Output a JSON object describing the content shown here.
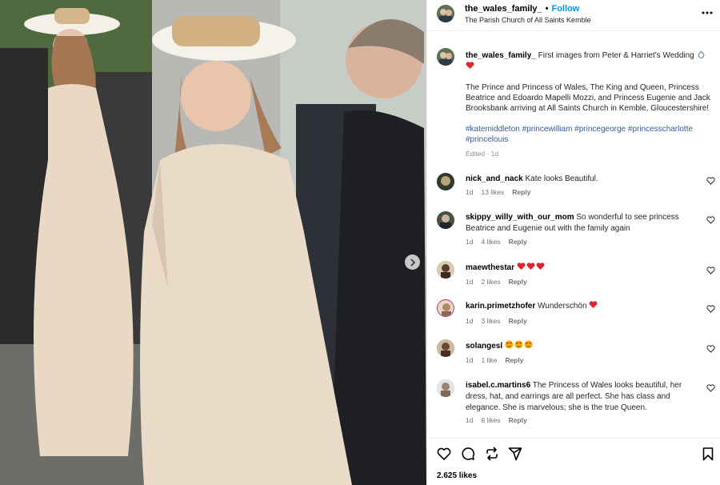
{
  "post": {
    "username": "the_wales_family_",
    "separator": "•",
    "follow_label": "Follow",
    "location": "The Parish Church of All Saints Kemble",
    "more_icon": "more-horizontal-icon"
  },
  "caption": {
    "username": "the_wales_family_",
    "text": "First images from Peter & Harriet's Wedding",
    "body": "The Prince and Princess of Wales, The King and Queen, Princess Beatrice and Edoardo Mapelli Mozzi, and Princess Eugenie and Jack Brooksbank arriving at All Saints Church in Kemble, Gloucestershire!",
    "hashtags": "#katemiddleton #princewilliam #princegeorge #princesscharlotte #princelouis",
    "edited": "Edited · 1d"
  },
  "comments": [
    {
      "username": "nick_and_nack",
      "text": "Kate looks Beautiful.",
      "age": "1d",
      "likes": "13 likes",
      "reply": "Reply"
    },
    {
      "username": "skippy_willy_with_our_mom",
      "text": "So wonderful to see princess Beatrice and Eugenie out with the family again",
      "age": "1d",
      "likes": "4 likes",
      "reply": "Reply"
    },
    {
      "username": "maewthestar",
      "text": "",
      "age": "1d",
      "likes": "2 likes",
      "reply": "Reply"
    },
    {
      "username": "karin.primetzhofer",
      "text": "Wunderschön",
      "age": "1d",
      "likes": "3 likes",
      "reply": "Reply"
    },
    {
      "username": "solangesl",
      "text": "",
      "age": "1d",
      "likes": "1 like",
      "reply": "Reply"
    },
    {
      "username": "isabel.c.martins6",
      "text": "The Princess of Wales looks beautiful, her dress, hat, and earrings are all perfect. She has class and elegance. She is marvelous; she is the true Queen.",
      "age": "1d",
      "likes": "8 likes",
      "reply": "Reply"
    }
  ],
  "actions": {
    "like_icon": "heart-icon",
    "comment_icon": "comment-icon",
    "repost_icon": "repost-icon",
    "share_icon": "send-icon",
    "save_icon": "bookmark-icon",
    "likes_count": "2.625 likes"
  },
  "carousel": {
    "next_icon": "chevron-right-icon"
  },
  "colors": {
    "link": "#0095f6",
    "hashtag": "#385898",
    "heart": "#ed4956",
    "muted": "#737373"
  }
}
